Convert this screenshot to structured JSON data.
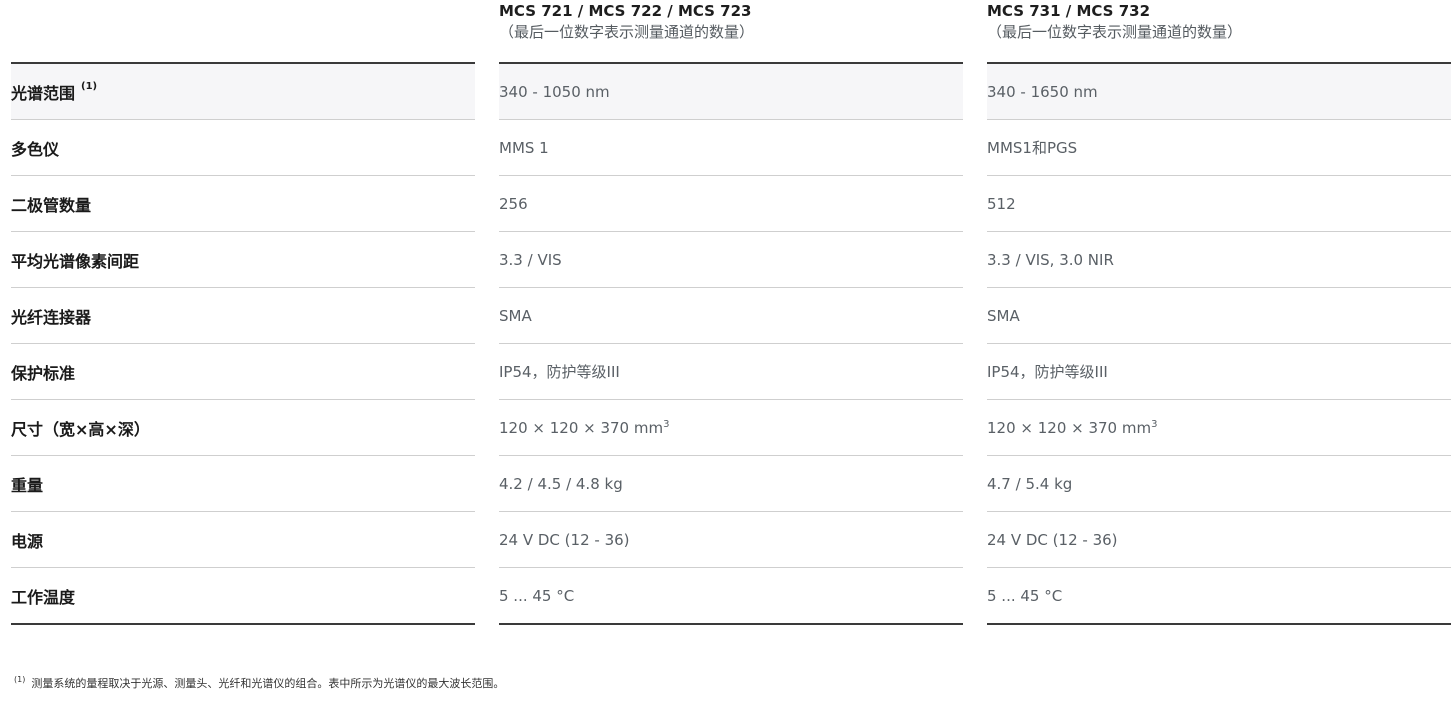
{
  "columns": [
    {
      "model": "MCS 721 / MCS 722 / MCS 723",
      "note": "（最后一位数字表示测量通道的数量）"
    },
    {
      "model": "MCS 731 / MCS 732",
      "note": "（最后一位数字表示测量通道的数量）"
    }
  ],
  "rows": [
    {
      "label": "光谱范围",
      "footnote_mark": "(1)",
      "a": "340 - 1050 nm",
      "b": "340 - 1650 nm"
    },
    {
      "label": "多色仪",
      "a": "MMS 1",
      "b": "MMS1和PGS"
    },
    {
      "label": "二极管数量",
      "a": "256",
      "b": "512"
    },
    {
      "label": "平均光谱像素间距",
      "a": "3.3 / VIS",
      "b": "3.3 / VIS, 3.0 NIR"
    },
    {
      "label": "光纤连接器",
      "a": "SMA",
      "b": "SMA"
    },
    {
      "label": "保护标准",
      "a": "IP54，防护等级III",
      "b": "IP54，防护等级III"
    },
    {
      "label": "尺寸（宽×高×深）",
      "a": "120 × 120 × 370 mm",
      "a_sup": "3",
      "b": "120 × 120 × 370 mm",
      "b_sup": "3"
    },
    {
      "label": "重量",
      "a": "4.2 / 4.5 / 4.8 kg",
      "b": "4.7 / 5.4 kg"
    },
    {
      "label": "电源",
      "a": "24 V DC (12 - 36)",
      "b": "24 V DC (12 - 36)"
    },
    {
      "label": "工作温度",
      "a": "5 ... 45 °C",
      "b": "5 ... 45 °C"
    }
  ],
  "footnote": {
    "mark": "(1)",
    "text": "测量系统的量程取决于光源、测量头、光纤和光谱仪的组合。表中所示为光谱仪的最大波长范围。"
  }
}
